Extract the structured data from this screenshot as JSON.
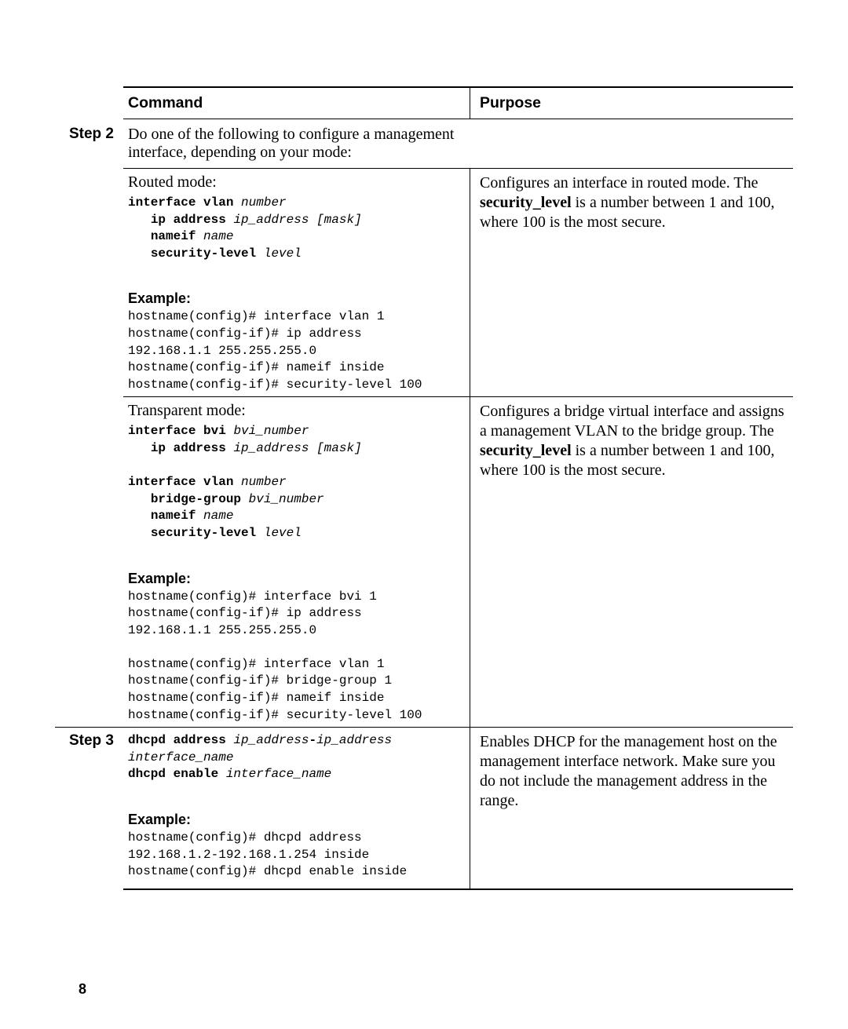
{
  "page_number": "8",
  "table": {
    "header": {
      "command": "Command",
      "purpose": "Purpose"
    },
    "step2": {
      "label": "Step 2",
      "intro": "Do one of the following to configure a management interface, depending on your mode:",
      "routed": {
        "title": "Routed mode:",
        "syntax": {
          "l1_kw": "interface vlan",
          "l1_arg": "number",
          "l2_kw": "ip address",
          "l2_arg": "ip_address",
          "l2_opt": "[mask]",
          "l3_kw": "nameif",
          "l3_arg": "name",
          "l4_kw": "security-level",
          "l4_arg": "level"
        },
        "example_label": "Example:",
        "example": "hostname(config)# interface vlan 1\nhostname(config-if)# ip address \n192.168.1.1 255.255.255.0\nhostname(config-if)# nameif inside\nhostname(config-if)# security-level 100",
        "purpose_pre": "Configures an interface in routed mode. The ",
        "purpose_bold": "security_level",
        "purpose_post": " is a number between 1 and 100, where 100 is the most secure."
      },
      "transparent": {
        "title": "Transparent mode:",
        "syntax": {
          "a1_kw": "interface bvi",
          "a1_arg": "bvi_number",
          "a2_kw": "ip address",
          "a2_arg": "ip_address",
          "a2_opt": "[mask]",
          "b1_kw": "interface vlan",
          "b1_arg": "number",
          "b2_kw": "bridge-group",
          "b2_arg": "bvi_number",
          "b3_kw": "nameif",
          "b3_arg": "name",
          "b4_kw": "security-level",
          "b4_arg": "level"
        },
        "example_label": "Example:",
        "example": "hostname(config)# interface bvi 1\nhostname(config-if)# ip address \n192.168.1.1 255.255.255.0\n\nhostname(config)# interface vlan 1\nhostname(config-if)# bridge-group 1\nhostname(config-if)# nameif inside\nhostname(config-if)# security-level 100",
        "purpose_pre": "Configures a bridge virtual interface and assigns a management VLAN to the bridge group. The ",
        "purpose_bold": "security_level",
        "purpose_post": " is a number between 1 and 100, where 100 is the most secure."
      }
    },
    "step3": {
      "label": "Step 3",
      "syntax": {
        "l1_kw": "dhcpd address",
        "l1_a": "ip_address",
        "l1_dash": "-",
        "l1_b": "ip_address",
        "l2_arg": "interface_name",
        "l3_kw": "dhcpd enable",
        "l3_arg": "interface_name"
      },
      "example_label": "Example:",
      "example": "hostname(config)# dhcpd address \n192.168.1.2-192.168.1.254 inside\nhostname(config)# dhcpd enable inside",
      "purpose": "Enables DHCP for the management host on the management interface network. Make sure you do not include the management address in the range."
    }
  }
}
